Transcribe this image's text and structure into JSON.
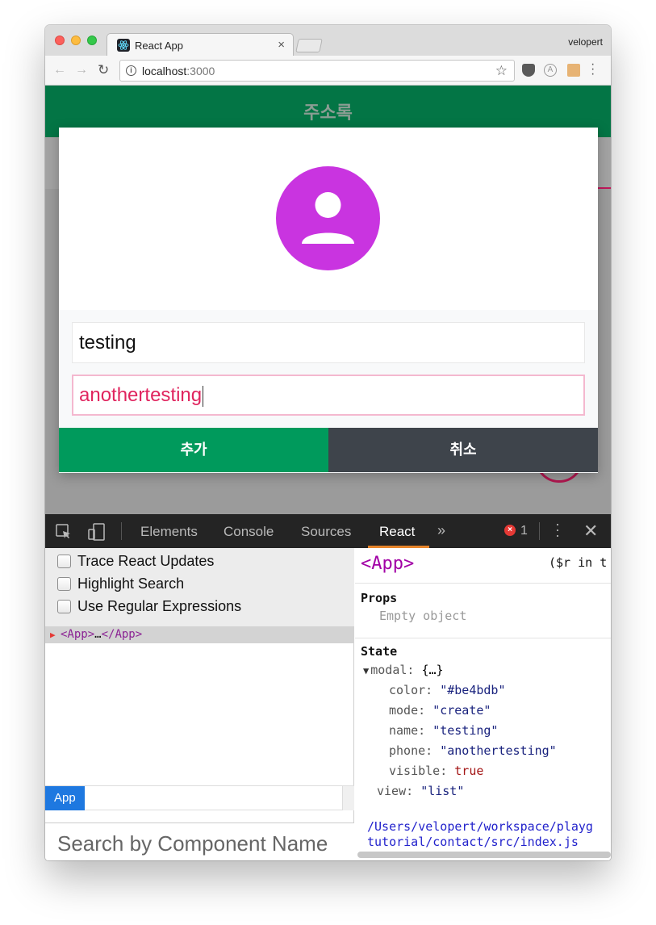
{
  "browser": {
    "tab_title": "React App",
    "tab_close": "×",
    "profile_name": "velopert",
    "url_host": "localhost",
    "url_port": ":3000",
    "back": "←",
    "forward": "→",
    "reload": "↻",
    "star": "☆",
    "info": "i",
    "ext_a": "A"
  },
  "app": {
    "title": "주소록",
    "modal": {
      "name_value": "testing",
      "phone_value": "anothertesting",
      "add_label": "추가",
      "cancel_label": "취소",
      "avatar_color": "#c934e0"
    },
    "header_color": "#037545"
  },
  "devtools": {
    "tabs": [
      "Elements",
      "Console",
      "Sources",
      "React"
    ],
    "active_tab": "React",
    "more": "»",
    "error_count": "1",
    "error_icon": "×",
    "close": "✕",
    "options": [
      "Trace React Updates",
      "Highlight Search",
      "Use Regular Expressions"
    ],
    "tree_node": {
      "open": "<App>",
      "ellipsis": "…",
      "close": "</App>"
    },
    "breadcrumb": "App",
    "search_placeholder": "Search by Component Name",
    "inspector": {
      "component": "<App>",
      "console_hint": "($r in t",
      "props_title": "Props",
      "props_empty": "Empty object",
      "state_title": "State",
      "modal_key": "modal:",
      "modal_summary": "{…}",
      "color_key": "color:",
      "color_value": "\"#be4bdb\"",
      "mode_key": "mode:",
      "mode_value": "\"create\"",
      "name_key": "name:",
      "name_value": "\"testing\"",
      "phone_key": "phone:",
      "phone_value": "\"anothertesting\"",
      "visible_key": "visible:",
      "visible_value": "true",
      "view_key": "view:",
      "view_value": "\"list\"",
      "source_line1": "/Users/velopert/workspace/playg",
      "source_line2": "tutorial/contact/src/index.js"
    }
  }
}
